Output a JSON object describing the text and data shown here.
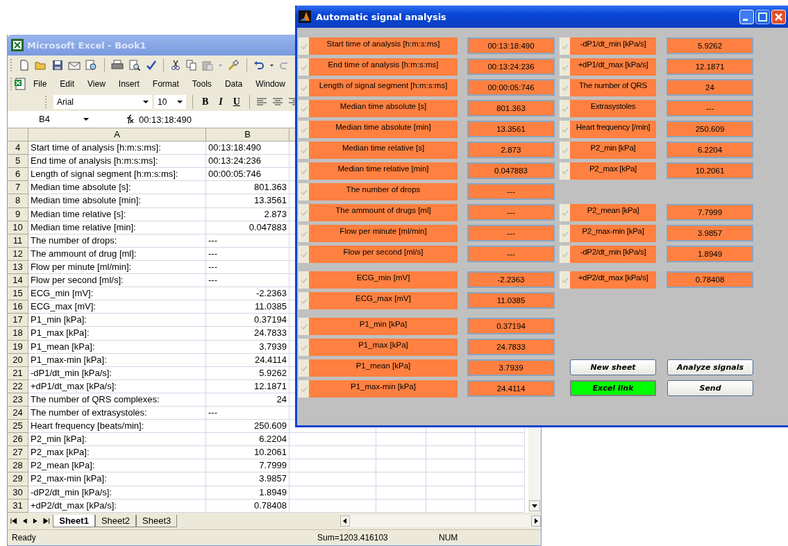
{
  "excel": {
    "title": "Microsoft Excel - Book1",
    "menu": [
      "File",
      "Edit",
      "View",
      "Insert",
      "Format",
      "Tools",
      "Data",
      "Window"
    ],
    "font": "Arial",
    "font_size": "10",
    "format_buttons": [
      "B",
      "I",
      "U"
    ],
    "name_box": "B4",
    "formula": "00:13:18:490",
    "columns": [
      "A",
      "B"
    ],
    "rows": [
      {
        "number": "4",
        "label": "Start time of analysis [h:m:s:ms]:",
        "value": "00:13:18:490",
        "numeric": false
      },
      {
        "number": "5",
        "label": "End time of analysis [h:m:s:ms]:",
        "value": "00:13:24:236",
        "numeric": false
      },
      {
        "number": "6",
        "label": "Length of signal segment [h:m:s:ms]:",
        "value": "00:00:05:746",
        "numeric": false
      },
      {
        "number": "7",
        "label": "Median time absolute [s]:",
        "value": "801.363",
        "numeric": true
      },
      {
        "number": "8",
        "label": "Median time absolute [min]:",
        "value": "13.3561",
        "numeric": true
      },
      {
        "number": "9",
        "label": "Median time relative [s]:",
        "value": "2.873",
        "numeric": true
      },
      {
        "number": "10",
        "label": "Median time relative [min]:",
        "value": "0.047883",
        "numeric": true
      },
      {
        "number": "11",
        "label": "The number of drops:",
        "value": "---",
        "numeric": false
      },
      {
        "number": "12",
        "label": "The ammount of drug [ml]:",
        "value": "---",
        "numeric": false
      },
      {
        "number": "13",
        "label": "Flow per minute [ml/min]:",
        "value": "---",
        "numeric": false
      },
      {
        "number": "14",
        "label": "Flow per second [ml/s]:",
        "value": "---",
        "numeric": false
      },
      {
        "number": "15",
        "label": "ECG_min [mV]:",
        "value": "-2.2363",
        "numeric": true
      },
      {
        "number": "16",
        "label": "ECG_max [mV]:",
        "value": "11.0385",
        "numeric": true
      },
      {
        "number": "17",
        "label": "P1_min [kPa]:",
        "value": "0.37194",
        "numeric": true
      },
      {
        "number": "18",
        "label": "P1_max [kPa]:",
        "value": "24.7833",
        "numeric": true
      },
      {
        "number": "19",
        "label": "P1_mean [kPa]:",
        "value": "3.7939",
        "numeric": true
      },
      {
        "number": "20",
        "label": "P1_max-min [kPa]:",
        "value": "24.4114",
        "numeric": true
      },
      {
        "number": "21",
        "label": "-dP1/dt_min [kPa/s]:",
        "value": "5.9262",
        "numeric": true
      },
      {
        "number": "22",
        "label": "+dP1/dt_max [kPa/s]:",
        "value": "12.1871",
        "numeric": true
      },
      {
        "number": "23",
        "label": "The number of QRS complexes:",
        "value": "24",
        "numeric": true
      },
      {
        "number": "24",
        "label": "The number of extrasystoles:",
        "value": "---",
        "numeric": false
      },
      {
        "number": "25",
        "label": "Heart frequency [beats/min]:",
        "value": "250.609",
        "numeric": true
      },
      {
        "number": "26",
        "label": "P2_min [kPa]:",
        "value": "6.2204",
        "numeric": true
      },
      {
        "number": "27",
        "label": "P2_max [kPa]:",
        "value": "10.2061",
        "numeric": true
      },
      {
        "number": "28",
        "label": "P2_mean [kPa]:",
        "value": "7.7999",
        "numeric": true
      },
      {
        "number": "29",
        "label": "P2_max-min [kPa]:",
        "value": "3.9857",
        "numeric": true
      },
      {
        "number": "30",
        "label": "-dP2/dt_min [kPa/s]:",
        "value": "1.8949",
        "numeric": true
      },
      {
        "number": "31",
        "label": "+dP2/dt_max [kPa/s]:",
        "value": "0.78408",
        "numeric": true
      }
    ],
    "sheets": [
      {
        "label": "Sheet1",
        "selected": true
      },
      {
        "label": "Sheet2",
        "selected": false
      },
      {
        "label": "Sheet3",
        "selected": false
      }
    ],
    "status": {
      "mode": "Ready",
      "sum": "Sum=1203.416103",
      "num": "NUM"
    }
  },
  "dialog": {
    "title": "Automatic signal analysis",
    "sections": [
      {
        "rows": [
          {
            "left": {
              "label": "Start time of analysis [h:m:s:ms]",
              "value": "00:13:18:490",
              "checked": true
            },
            "right": {
              "label": "-dP1/dt_min [kPa/s]",
              "value": "5.9262",
              "checked": true
            }
          },
          {
            "left": {
              "label": "End time of analysis [h:m:s:ms]",
              "value": "00:13:24:236",
              "checked": true
            },
            "right": {
              "label": "+dP1/dt_max [kPa/s]",
              "value": "12.1871",
              "checked": true
            }
          },
          {
            "left": {
              "label": "Length of signal segment [h:m:s:ms]",
              "value": "00:00:05:746",
              "checked": true
            },
            "right": {
              "label": "The number of QRS",
              "value": "24",
              "checked": true
            }
          },
          {
            "left": {
              "label": "Median time absolute [s]",
              "value": "801.363",
              "checked": true
            },
            "right": {
              "label": "Extrasystoles",
              "value": "---",
              "checked": true
            }
          },
          {
            "left": {
              "label": "Median time absolute [min]",
              "value": "13.3561",
              "checked": true
            },
            "right": {
              "label": "Heart frequency [/min]",
              "value": "250.609",
              "checked": true
            }
          },
          {
            "left": {
              "label": "Median time relative [s]",
              "value": "2.873",
              "checked": true
            },
            "right": {
              "label": "P2_min [kPa]",
              "value": "6.2204",
              "checked": true
            }
          },
          {
            "left": {
              "label": "Median time relative [min]",
              "value": "0.047883",
              "checked": true
            },
            "right": {
              "label": "P2_max [kPa]",
              "value": "10.2061",
              "checked": true
            }
          },
          {
            "left": {
              "label": "The number of drops",
              "value": "---",
              "checked": true
            }
          },
          {
            "left": {
              "label": "The ammount of drugs [ml]",
              "value": "---",
              "checked": true
            },
            "right": {
              "label": "P2_mean [kPa]",
              "value": "7.7999",
              "checked": true
            }
          },
          {
            "left": {
              "label": "Flow per minute [ml/min]",
              "value": "---",
              "checked": true
            },
            "right": {
              "label": "P2_max-min [kPa]",
              "value": "3.9857",
              "checked": true
            }
          },
          {
            "left": {
              "label": "Flow per second [ml/s]",
              "value": "---",
              "checked": true
            },
            "right": {
              "label": "-dP2/dt_min [kPa/s]",
              "value": "1.8949",
              "checked": true
            }
          }
        ]
      },
      {
        "rows": [
          {
            "left": {
              "label": "ECG_min [mV]",
              "value": "-2.2363",
              "checked": true
            },
            "right": {
              "label": "+dP2/dt_max [kPa/s]",
              "value": "0.78408",
              "checked": true
            }
          },
          {
            "left": {
              "label": "ECG_max [mV]",
              "value": "11.0385",
              "checked": true
            }
          }
        ]
      },
      {
        "rows": [
          {
            "left": {
              "label": "P1_min [kPa]",
              "value": "0.37194",
              "checked": true
            }
          },
          {
            "left": {
              "label": "P1_max [kPa]",
              "value": "24.7833",
              "checked": true
            }
          },
          {
            "left": {
              "label": "P1_mean [kPa]",
              "value": "3.7939",
              "checked": true
            },
            "buttons": [
              {
                "label": "New sheet",
                "active": false
              },
              {
                "label": "Analyze signals",
                "active": false
              }
            ]
          },
          {
            "left": {
              "label": "P1_max-min [kPa]",
              "value": "24.4114",
              "checked": true
            },
            "buttons": [
              {
                "label": "Excel link",
                "active": true
              },
              {
                "label": "Send",
                "active": false
              }
            ]
          }
        ]
      }
    ]
  }
}
